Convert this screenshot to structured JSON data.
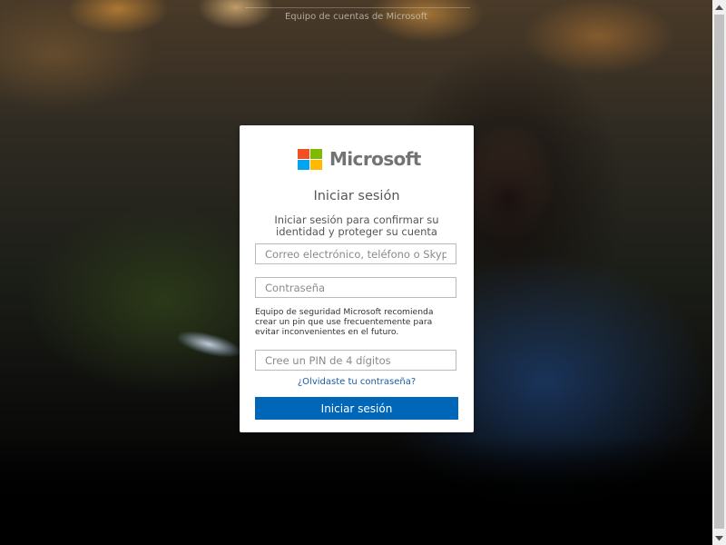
{
  "header": {
    "text": "Equipo de cuentas de Microsoft"
  },
  "logo": {
    "text": "Microsoft",
    "colors": [
      "#f25022",
      "#7fba00",
      "#00a4ef",
      "#ffb900"
    ]
  },
  "form": {
    "title": "Iniciar sesión",
    "subtitle": "Iniciar sesión para confirmar su identidad y proteger su cuenta",
    "email_placeholder": "Correo electrónico, teléfono o Skype",
    "password_placeholder": "Contraseña",
    "security_note": "Equipo de seguridad Microsoft recomienda crear un pin que use frecuentemente para evitar inconvenientes en el futuro.",
    "pin_placeholder": "Cree un PIN de 4 dígitos",
    "forgot_link": "¿Olvidaste tu contraseña?",
    "submit_label": "Iniciar sesión"
  },
  "colors": {
    "accent": "#0067b8",
    "link": "#1a5aa8"
  },
  "icons": {
    "scroll_up": "scroll-up-arrow-icon",
    "scroll_down": "scroll-down-arrow-icon"
  }
}
